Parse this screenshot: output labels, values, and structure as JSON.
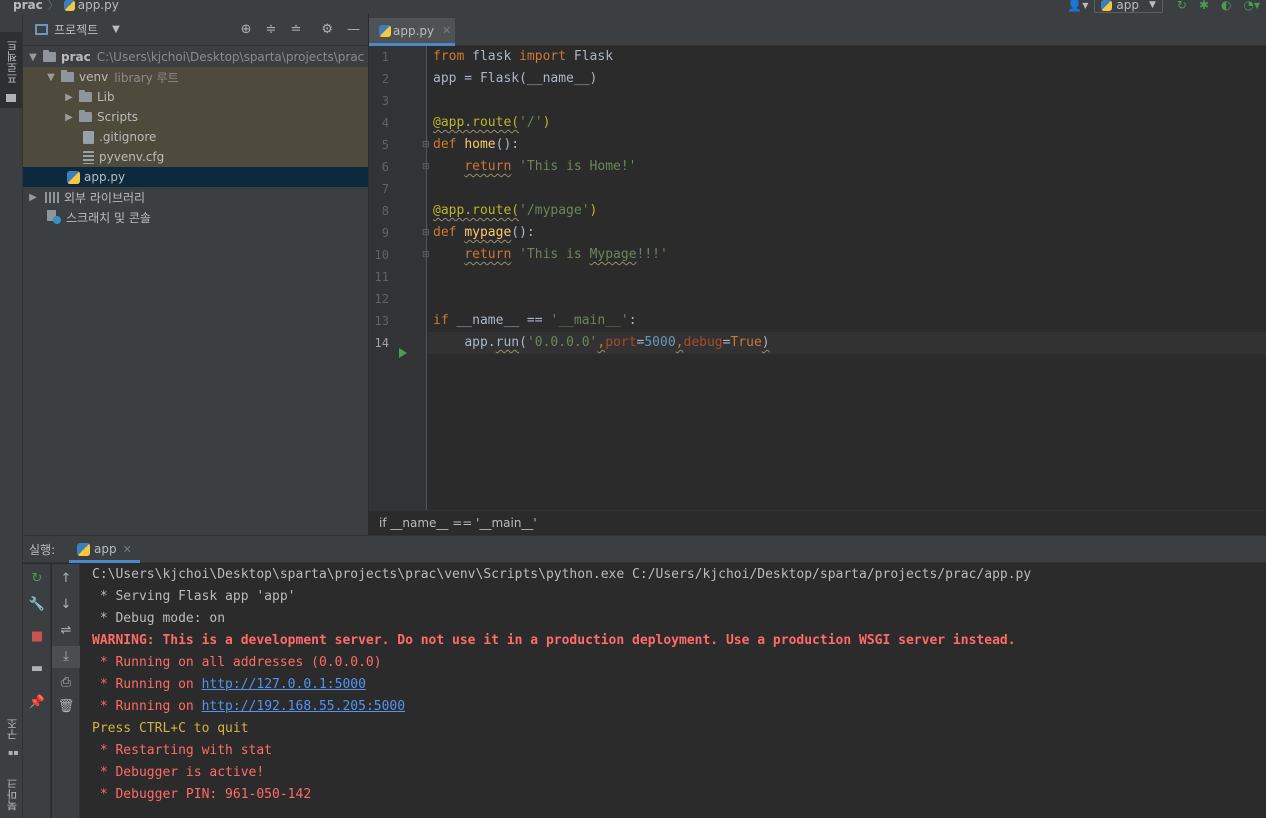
{
  "navbar": {
    "project": "prac",
    "file": "app.py",
    "run_config": "app"
  },
  "left_strip": {
    "project_tab": "프로젝트",
    "structure_tab": "구조",
    "bookmarks_tab": "북마크"
  },
  "project_panel": {
    "title": "프로젝트",
    "tree": {
      "root_name": "prac",
      "root_path": "C:\\Users\\kjchoi\\Desktop\\sparta\\projects\\prac",
      "venv_name": "venv",
      "venv_note": "library 루트",
      "lib": "Lib",
      "scripts": "Scripts",
      "gitignore": ".gitignore",
      "pyvenv": "pyvenv.cfg",
      "app": "app.py",
      "external_libs": "외부 라이브러리",
      "scratches": "스크래치 및 콘솔"
    }
  },
  "editor": {
    "tab_label": "app.py",
    "breadcrumb": "if __name__ == '__main__'",
    "line_numbers": [
      "1",
      "2",
      "3",
      "4",
      "5",
      "6",
      "7",
      "8",
      "9",
      "10",
      "11",
      "12",
      "13",
      "14"
    ],
    "code": {
      "l1_kw1": "from",
      "l1_mod": " flask ",
      "l1_kw2": "import",
      "l1_cls": " Flask",
      "l2": "app = Flask(__name__)",
      "l4_dec": "@app.route(",
      "l4_str": "'/'",
      "l4_close": ")",
      "l5_kw": "def",
      "l5_fn": "home",
      "l5_rest": "():",
      "l6_kw": "return",
      "l6_str": "'This is Home!'",
      "l8_dec": "@app.route(",
      "l8_str": "'/mypage'",
      "l8_close": ")",
      "l9_kw": "def",
      "l9_fn": "mypage",
      "l9_rest": "():",
      "l10_kw": "return",
      "l10_str_a": "'This is ",
      "l10_str_b": "Mypage",
      "l10_str_c": "!!!'",
      "l13_kw": "if",
      "l13_mid": " __name__ == ",
      "l13_str": "'__main__'",
      "l13_end": ":",
      "l14_a": "app.",
      "l14_fn": "run",
      "l14_b": "(",
      "l14_str": "'0.0.0.0'",
      "l14_c": ",",
      "l14_p1": "port",
      "l14_eq1": "=",
      "l14_num": "5000",
      "l14_d": ",",
      "l14_p2": "debug",
      "l14_eq2": "=",
      "l14_kw": "True",
      "l14_e": ")"
    }
  },
  "run_panel": {
    "label": "실행:",
    "tab": "app",
    "console": {
      "l1": "C:\\Users\\kjchoi\\Desktop\\sparta\\projects\\prac\\venv\\Scripts\\python.exe C:/Users/kjchoi/Desktop/sparta/projects/prac/app.py",
      "l2": " * Serving Flask app 'app'",
      "l3": " * Debug mode: on",
      "l4": "WARNING: This is a development server. Do not use it in a production deployment. Use a production WSGI server instead.",
      "l5": " * Running on all addresses (0.0.0.0)",
      "l6_prefix": " * Running on ",
      "l6_link": "http://127.0.0.1:5000",
      "l7_prefix": " * Running on ",
      "l7_link": "http://192.168.55.205:5000",
      "l8": "Press CTRL+C to quit",
      "l9": " * Restarting with stat",
      "l10": " * Debugger is active!",
      "l11": " * Debugger PIN: 961-050-142"
    }
  },
  "colors": {
    "keyword": "#cc7832",
    "string": "#6a8759",
    "decorator": "#bbb529",
    "number": "#6897bb",
    "function": "#ffc66d",
    "error_text": "#ff6b68",
    "link": "#5394ec",
    "hint_yellow": "#d3b144"
  }
}
